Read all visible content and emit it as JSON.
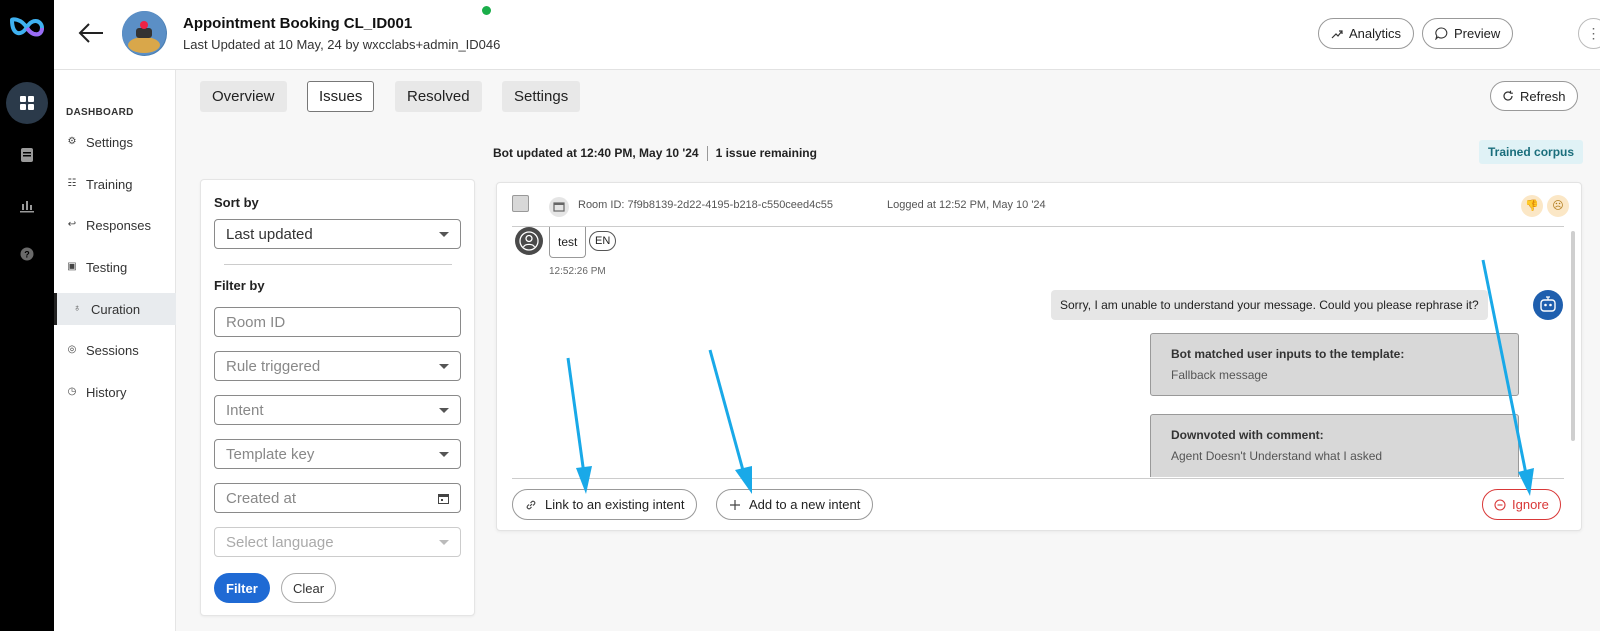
{
  "header": {
    "title": "Appointment Booking CL_ID001",
    "subtitle": "Last Updated at 10 May, 24 by wxcclabs+admin_ID046",
    "analytics_label": "Analytics",
    "preview_label": "Preview",
    "more_label": "⋮"
  },
  "sidebar": {
    "section_label": "DASHBOARD",
    "items": [
      {
        "label": "Settings",
        "icon": "gear-icon"
      },
      {
        "label": "Training",
        "icon": "training-icon"
      },
      {
        "label": "Responses",
        "icon": "reply-icon"
      },
      {
        "label": "Testing",
        "icon": "testing-icon"
      },
      {
        "label": "Curation",
        "icon": "lightbulb-icon"
      },
      {
        "label": "Sessions",
        "icon": "sessions-icon"
      },
      {
        "label": "History",
        "icon": "history-icon"
      }
    ],
    "active": "Curation"
  },
  "tabs": {
    "overview": "Overview",
    "issues": "Issues",
    "resolved": "Resolved",
    "settings": "Settings",
    "active": "Issues"
  },
  "refresh_label": "Refresh",
  "status": {
    "bot_updated": "Bot updated at 12:40 PM, May 10 '24",
    "remaining": "1 issue remaining",
    "trained_corpus": "Trained corpus"
  },
  "filters": {
    "sort_by_label": "Sort by",
    "sort_value": "Last updated",
    "filter_by_label": "Filter by",
    "room_id_placeholder": "Room ID",
    "rule_triggered_placeholder": "Rule triggered",
    "intent_placeholder": "Intent",
    "template_key_placeholder": "Template key",
    "created_at_placeholder": "Created at",
    "language_placeholder": "Select language",
    "filter_button": "Filter",
    "clear_button": "Clear"
  },
  "issue": {
    "room_id": "Room ID: 7f9b8139-2d22-4195-b218-c550ceed4c55",
    "logged_at": "Logged at 12:52 PM, May 10 '24",
    "user_message": "test",
    "language_badge": "EN",
    "user_time": "12:52:26 PM",
    "bot_message": "Sorry, I am unable to understand your message. Could you please rephrase it?",
    "matched_heading": "Bot matched user inputs to the template:",
    "matched_value": "Fallback message",
    "downvote_heading": "Downvoted with comment:",
    "downvote_value": "Agent Doesn't Understand what I asked"
  },
  "actions": {
    "link_existing": "Link to an existing intent",
    "add_new": "Add to a new intent",
    "ignore": "Ignore"
  },
  "colors": {
    "accent": "#1f6ad4",
    "danger": "#d93838",
    "annotation_arrow": "#19a9e8"
  }
}
